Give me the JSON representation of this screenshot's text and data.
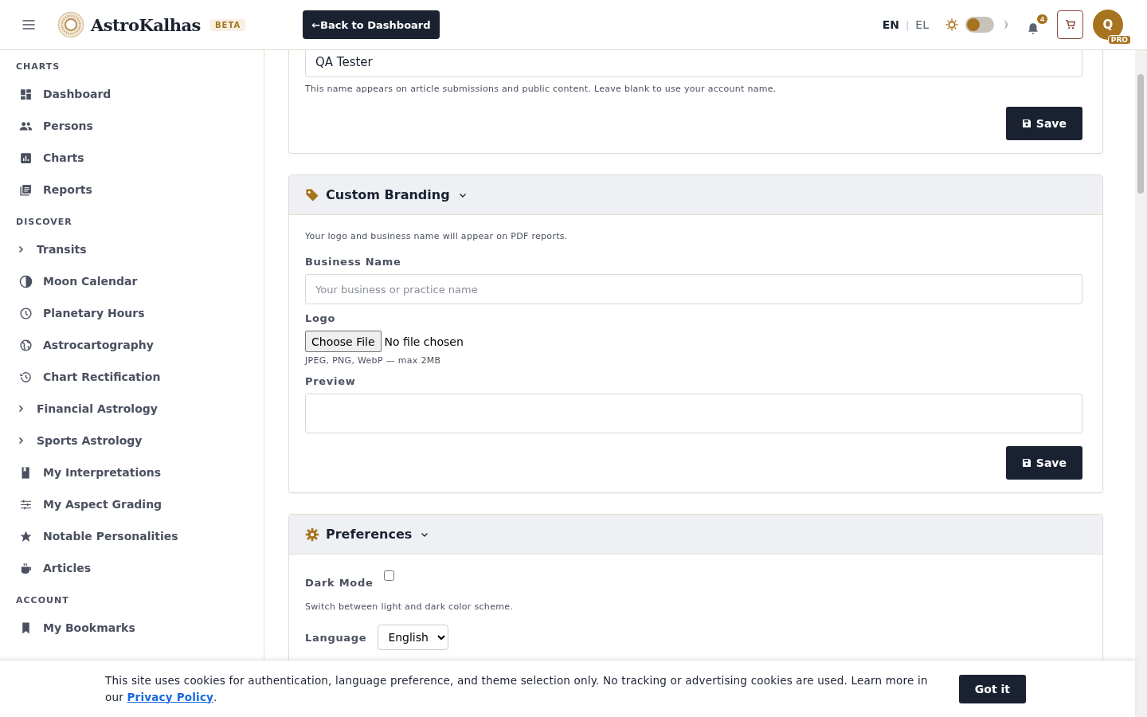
{
  "header": {
    "brand": "AstroKalhas",
    "badge": "BETA",
    "back_button": "←Back to Dashboard",
    "languages": [
      {
        "label": "EN",
        "selected": true
      },
      {
        "label": "EL",
        "selected": false
      }
    ],
    "language_separator": "|",
    "theme_toggle": {
      "on": false
    },
    "notifications": "4",
    "avatar": {
      "initial": "Q",
      "badge": "PRO"
    }
  },
  "sidebar": {
    "sections": [
      {
        "title": "CHARTS",
        "items": [
          {
            "label": "Dashboard",
            "kind": "link"
          },
          {
            "label": "Persons",
            "kind": "link"
          },
          {
            "label": "Charts",
            "kind": "link"
          },
          {
            "label": "Reports",
            "kind": "link"
          }
        ]
      },
      {
        "title": "DISCOVER",
        "items": [
          {
            "label": "Transits",
            "kind": "group",
            "expanded": false
          },
          {
            "label": "Moon Calendar",
            "kind": "link"
          },
          {
            "label": "Planetary Hours",
            "kind": "link"
          },
          {
            "label": "Astrocartography",
            "kind": "link"
          },
          {
            "label": "Chart Rectification",
            "kind": "link"
          },
          {
            "label": "Financial Astrology",
            "kind": "group",
            "expanded": false
          },
          {
            "label": "Sports Astrology",
            "kind": "group",
            "expanded": false
          },
          {
            "label": "My Interpretations",
            "kind": "link"
          },
          {
            "label": "My Aspect Grading",
            "kind": "link"
          },
          {
            "label": "Notable Personalities",
            "kind": "link"
          },
          {
            "label": "Articles",
            "kind": "link"
          }
        ]
      },
      {
        "title": "ACCOUNT",
        "items": [
          {
            "label": "My Bookmarks",
            "kind": "link"
          }
        ]
      }
    ]
  },
  "author_card": {
    "value": "QA Tester",
    "help": "This name appears on article submissions and public content. Leave blank to use your account name.",
    "save": "Save"
  },
  "branding_card": {
    "title": "Custom Branding",
    "expanded": true,
    "intro": "Your logo and business name will appear on PDF reports.",
    "business_label": "Business Name",
    "business_placeholder": "Your business or practice name",
    "logo_label": "Logo",
    "file_button": "Choose File",
    "file_status": "No file chosen",
    "file_help": "JPEG, PNG, WebP — max 2MB",
    "preview_label": "Preview",
    "save": "Save"
  },
  "preferences_card": {
    "title": "Preferences",
    "expanded": true,
    "dark_mode_label": "Dark Mode",
    "dark_mode_checked": false,
    "dark_mode_help": "Switch between light and dark color scheme.",
    "language_label": "Language",
    "language_value": "English"
  },
  "cookie_banner": {
    "text": "This site uses cookies for authentication, language preference, and theme selection only. No tracking or advertising cookies are used. Learn more in our ",
    "link": "Privacy Policy",
    "after": ".",
    "button": "Got it"
  }
}
